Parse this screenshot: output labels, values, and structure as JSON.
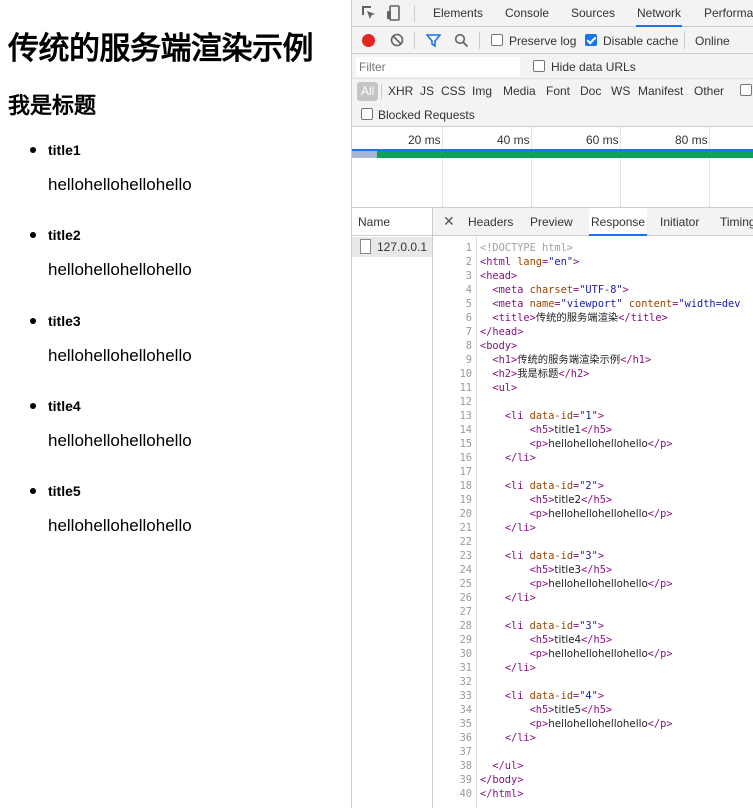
{
  "page": {
    "h1": "传统的服务端渲染示例",
    "h2": "我是标题",
    "items": [
      {
        "title": "title1",
        "text": "hellohellohellohello"
      },
      {
        "title": "title2",
        "text": "hellohellohellohello"
      },
      {
        "title": "title3",
        "text": "hellohellohellohello"
      },
      {
        "title": "title4",
        "text": "hellohellohellohello"
      },
      {
        "title": "title5",
        "text": "hellohellohellohello"
      }
    ]
  },
  "devtools": {
    "tabs": [
      "Elements",
      "Console",
      "Sources",
      "Network",
      "Performa"
    ],
    "active_tab": "Network",
    "toolbar": {
      "preserve_log": "Preserve log",
      "preserve_log_checked": false,
      "disable_cache": "Disable cache",
      "disable_cache_checked": true,
      "throttle": "Online"
    },
    "filter": {
      "placeholder": "Filter",
      "hide_data_urls": "Hide data URLs"
    },
    "types": [
      "All",
      "XHR",
      "JS",
      "CSS",
      "Img",
      "Media",
      "Font",
      "Doc",
      "WS",
      "Manifest",
      "Other"
    ],
    "blocked_requests": "Blocked Requests",
    "timeline_ticks": [
      "20 ms",
      "40 ms",
      "60 ms",
      "80 ms"
    ],
    "name_header": "Name",
    "request_name": "127.0.0.1",
    "detail_tabs": [
      "Headers",
      "Preview",
      "Response",
      "Initiator",
      "Timing"
    ],
    "active_detail_tab": "Response",
    "source_lines": [
      "<!DOCTYPE html>",
      "<html lang=\"en\">",
      "<head>",
      "  <meta charset=\"UTF-8\">",
      "  <meta name=\"viewport\" content=\"width=dev",
      "  <title>传统的服务端渲染</title>",
      "</head>",
      "<body>",
      "  <h1>传统的服务端渲染示例</h1>",
      "  <h2>我是标题</h2>",
      "  <ul>",
      "",
      "    <li data-id=\"1\">",
      "        <h5>title1</h5>",
      "        <p>hellohellohellohello</p>",
      "    </li>",
      "",
      "    <li data-id=\"2\">",
      "        <h5>title2</h5>",
      "        <p>hellohellohellohello</p>",
      "    </li>",
      "",
      "    <li data-id=\"3\">",
      "        <h5>title3</h5>",
      "        <p>hellohellohellohello</p>",
      "    </li>",
      "",
      "    <li data-id=\"3\">",
      "        <h5>title4</h5>",
      "        <p>hellohellohellohello</p>",
      "    </li>",
      "",
      "    <li data-id=\"4\">",
      "        <h5>title5</h5>",
      "        <p>hellohellohellohello</p>",
      "    </li>",
      "",
      "  </ul>",
      "</body>",
      "</html>"
    ]
  }
}
